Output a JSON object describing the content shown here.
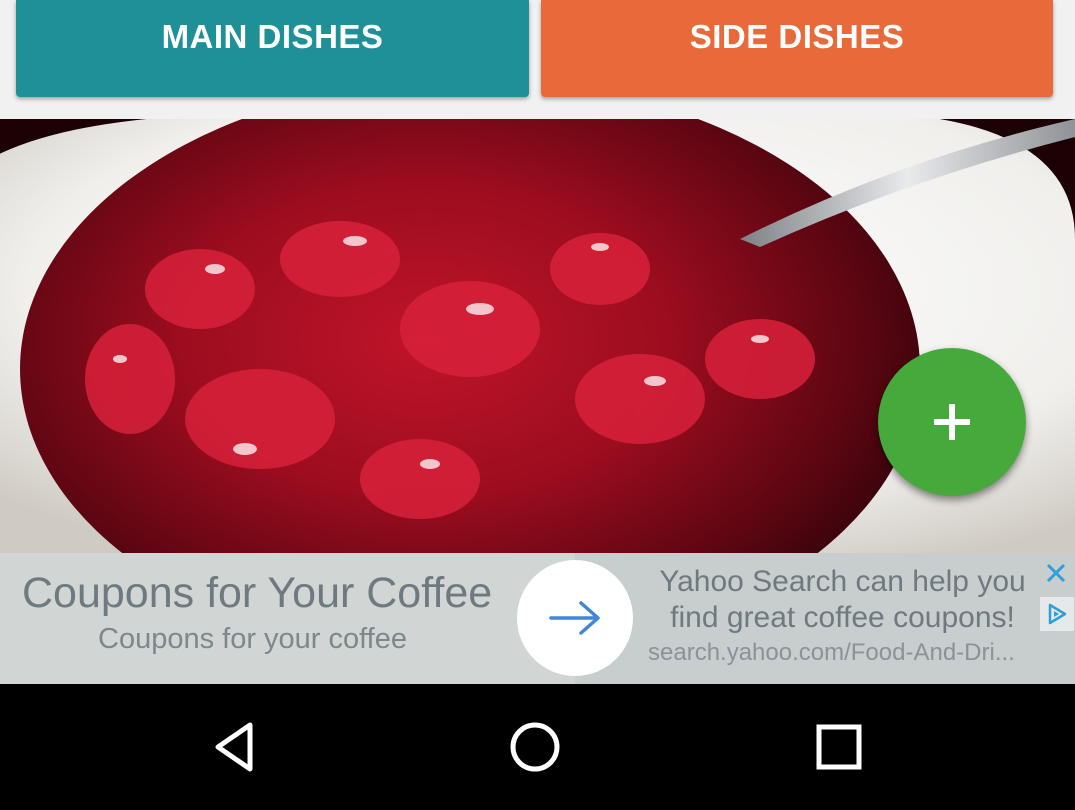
{
  "tabs": {
    "main_label": "MAIN DISHES",
    "side_label": "SIDE DISHES",
    "main_color": "#1f8f98",
    "side_color": "#e8693a"
  },
  "photo": {
    "icon": "cranberry-sauce-photo"
  },
  "fab": {
    "icon": "plus-icon",
    "color": "#45a93b"
  },
  "ad": {
    "title": "Coupons for Your Coffee",
    "subtitle": "Coupons for your coffee",
    "line1": "Yahoo Search can help you",
    "line2": "find great coffee coupons!",
    "url": "search.yahoo.com/Food-And-Dri...",
    "arrow_icon": "arrow-right-icon",
    "close_icon": "close-icon",
    "adchoices_icon": "adchoices-icon"
  },
  "navbar": {
    "back_icon": "back-triangle-icon",
    "home_icon": "home-circle-icon",
    "recents_icon": "recents-square-icon"
  }
}
